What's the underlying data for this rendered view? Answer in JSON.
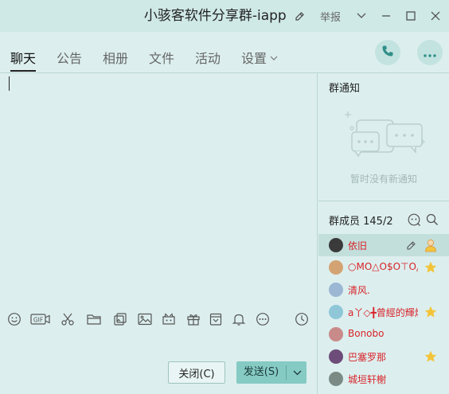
{
  "window": {
    "title": "小骇客软件分享群-iapp",
    "report_label": "举报"
  },
  "tabs": [
    {
      "label": "聊天",
      "active": true
    },
    {
      "label": "公告",
      "active": false
    },
    {
      "label": "相册",
      "active": false
    },
    {
      "label": "文件",
      "active": false
    },
    {
      "label": "活动",
      "active": false
    },
    {
      "label": "设置",
      "active": false
    }
  ],
  "composer": {
    "close_label": "关闭(C)",
    "send_label": "发送(S)",
    "tools": [
      "emoji-icon",
      "gif-icon",
      "scissors-icon",
      "folder-icon",
      "screenshot-icon",
      "image-icon",
      "wallet-icon",
      "gift-icon",
      "calendar-icon",
      "bell-icon",
      "more-icon",
      "history-icon"
    ]
  },
  "notice": {
    "title": "群通知",
    "empty_text": "暂时没有新通知"
  },
  "members": {
    "header": "群成员 145/2",
    "list": [
      {
        "name": "依旧",
        "badge": "owner",
        "avatar_color": "#3a3a3a",
        "selected": true
      },
      {
        "name": "○MO△O$O⊤O△O≡",
        "badge": "star",
        "avatar_color": "#d4a373",
        "selected": false
      },
      {
        "name": "清风.",
        "badge": "",
        "avatar_color": "#9bb7d4",
        "selected": false
      },
      {
        "name": "a丫◇╋曾經的輝煌",
        "badge": "star",
        "avatar_color": "#8fc7d9",
        "selected": false
      },
      {
        "name": "Bonobo",
        "badge": "",
        "avatar_color": "#c98a8a",
        "selected": false
      },
      {
        "name": "巴塞罗那",
        "badge": "star",
        "avatar_color": "#6d4c7a",
        "selected": false
      },
      {
        "name": "城垣轩榭",
        "badge": "",
        "avatar_color": "#7c8a86",
        "selected": false
      }
    ]
  },
  "colors": {
    "background": "#dcefee",
    "accent": "#86cac4",
    "member_name": "#d9232a",
    "star": "#f3c43a"
  }
}
